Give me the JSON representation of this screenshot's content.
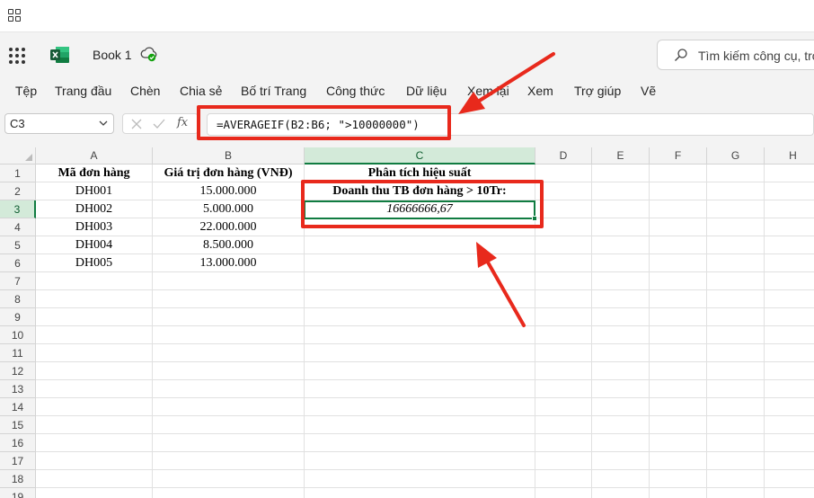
{
  "app": {
    "title": "Book 1",
    "search_placeholder": "Tìm kiếm công cụ, trợ"
  },
  "ribbon": {
    "tabs": [
      "Tệp",
      "Trang đầu",
      "Chèn",
      "Chia sẻ",
      "Bố trí Trang",
      "Công thức",
      "Dữ liệu",
      "Xem lại",
      "Xem",
      "Trợ giúp",
      "Vẽ"
    ]
  },
  "formula_bar": {
    "name_box": "C3",
    "fx_label": "fx",
    "formula": "=AVERAGEIF(B2:B6; \">10000000\")"
  },
  "sheet": {
    "column_headers": [
      "A",
      "B",
      "C",
      "D",
      "E",
      "F",
      "G",
      "H"
    ],
    "row_numbers": [
      "1",
      "2",
      "3",
      "4",
      "5",
      "6",
      "7",
      "8",
      "9",
      "10",
      "11",
      "12",
      "13",
      "14",
      "15",
      "16",
      "17",
      "18",
      "19"
    ],
    "header_a": "Mã đơn hàng",
    "header_b": "Giá trị đơn hàng (VNĐ)",
    "header_c": "Phân tích hiệu suất",
    "rows": [
      {
        "code": "DH001",
        "value": "15.000.000"
      },
      {
        "code": "DH002",
        "value": "5.000.000"
      },
      {
        "code": "DH003",
        "value": "22.000.000"
      },
      {
        "code": "DH004",
        "value": "8.500.000"
      },
      {
        "code": "DH005",
        "value": "13.000.000"
      }
    ],
    "c2_label": "Doanh thu TB đơn hàng > 10Tr:",
    "c3_result": "16666666,67",
    "active_cell": "C3"
  },
  "colors": {
    "accent": "#107c41",
    "annotation": "#e8291c"
  }
}
